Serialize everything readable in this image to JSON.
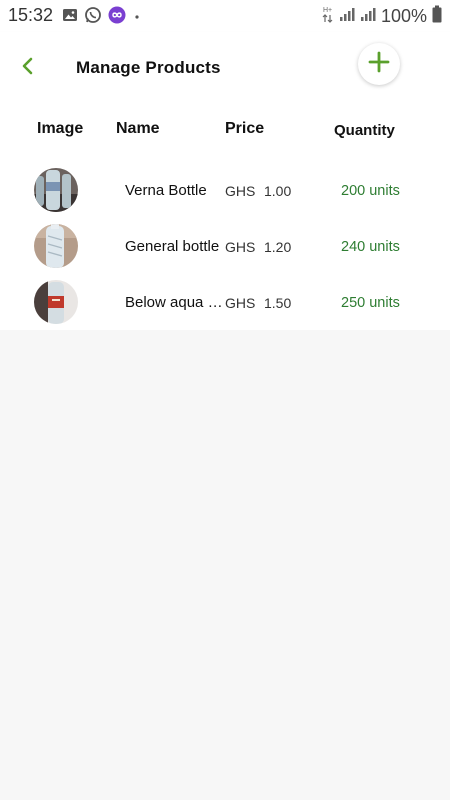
{
  "status_bar": {
    "time": "15:32",
    "battery_text": "100%",
    "network_label": "H+",
    "icons": [
      "image-icon",
      "whatsapp-icon",
      "app-notification-icon",
      "dot-icon",
      "data-arrows-icon",
      "signal-icon",
      "signal-icon",
      "battery-icon"
    ]
  },
  "app_bar": {
    "title": "Manage Products",
    "back_icon": "chevron-left-icon",
    "add_icon": "plus-icon"
  },
  "table": {
    "headers": {
      "image": "Image",
      "name": "Name",
      "price": "Price",
      "quantity": "Quantity"
    },
    "rows": [
      {
        "name": "Verna Bottle",
        "currency": "GHS",
        "price": "1.00",
        "quantity": "200 units"
      },
      {
        "name": "General bottle",
        "currency": "GHS",
        "price": "1.20",
        "quantity": "240 units"
      },
      {
        "name": "Below aqua b...",
        "currency": "GHS",
        "price": "1.50",
        "quantity": "250 units"
      }
    ]
  },
  "colors": {
    "accent": "#5aa02c",
    "quantity": "#2e7d32",
    "background": "#f7f7f7"
  }
}
